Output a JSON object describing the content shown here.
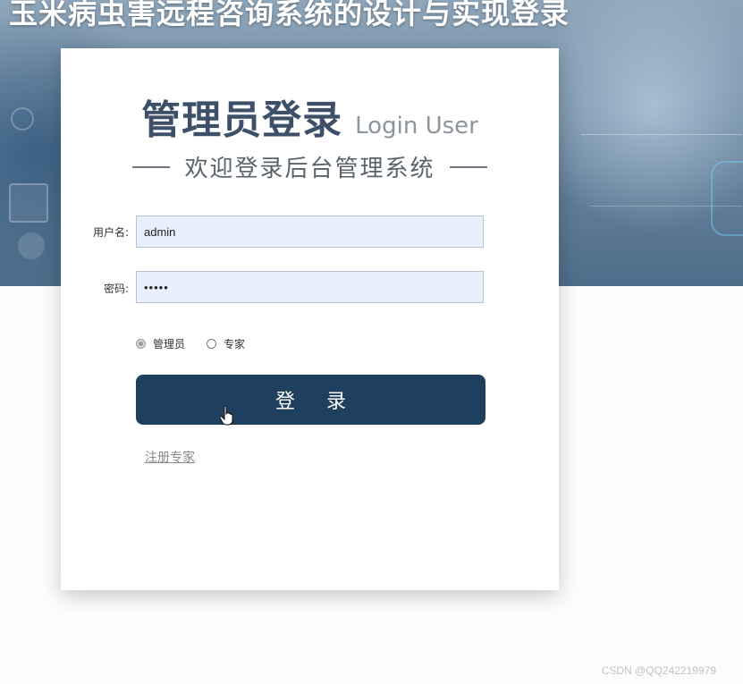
{
  "site_title": "玉米病虫害远程咨询系统的设计与实现登录",
  "card": {
    "heading_main": "管理员登录",
    "heading_sub": "Login User",
    "tagline": "欢迎登录后台管理系统"
  },
  "form": {
    "username_label": "用户名:",
    "username_value": "admin",
    "password_label": "密码:",
    "password_value": "•••••"
  },
  "roles": [
    {
      "label": "管理员",
      "selected": true
    },
    {
      "label": "专家",
      "selected": false
    }
  ],
  "login_button_label": "登 录",
  "register_link": "注册专家",
  "watermark": "CSDN @QQ242219979"
}
